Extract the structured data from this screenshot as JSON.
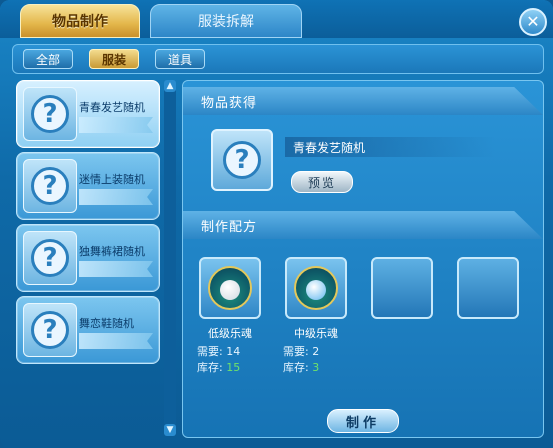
{
  "tabs": [
    {
      "label": "物品制作",
      "active": true
    },
    {
      "label": "服装拆解",
      "active": false
    }
  ],
  "close_label": "✕",
  "filters": [
    {
      "label": "全部",
      "selected": false
    },
    {
      "label": "服装",
      "selected": true
    },
    {
      "label": "道具",
      "selected": false
    }
  ],
  "recipes": [
    {
      "name": "青春发艺随机",
      "selected": true
    },
    {
      "name": "迷情上装随机",
      "selected": false
    },
    {
      "name": "独舞裤裙随机",
      "selected": false
    },
    {
      "name": "舞恋鞋随机",
      "selected": false
    }
  ],
  "detail": {
    "obtain_header": "物品获得",
    "obtain_name": "青春发艺随机",
    "preview_label": "预览",
    "recipe_header": "制作配方",
    "materials": [
      {
        "name": "低级乐魂",
        "need_label": "需要:",
        "need": "14",
        "stock_label": "库存:",
        "stock": "15"
      },
      {
        "name": "中级乐魂",
        "need_label": "需要:",
        "need": "2",
        "stock_label": "库存:",
        "stock": "3"
      }
    ],
    "make_label": "制作"
  },
  "colors": {
    "stock_ok": "#6fe36a",
    "active_tab": "#e3b64a"
  }
}
